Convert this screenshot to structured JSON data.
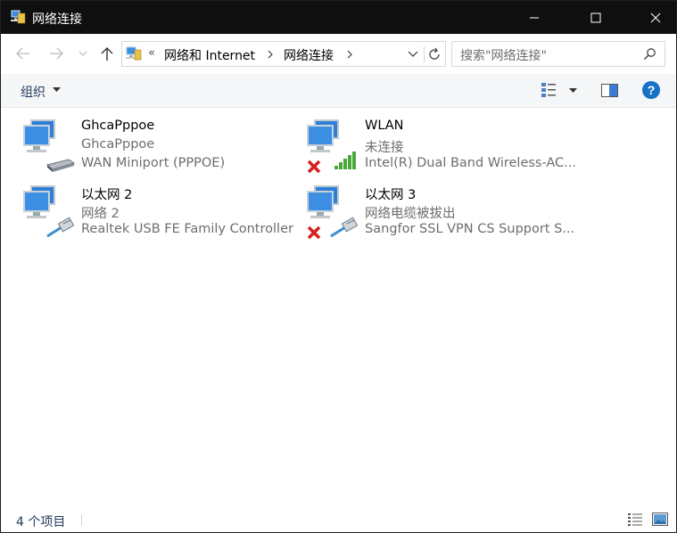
{
  "window": {
    "title": "网络连接",
    "accent": "#0f0f10"
  },
  "address": {
    "overflow": "«",
    "crumbs": [
      "网络和 Internet",
      "网络连接"
    ],
    "search_placeholder": "搜索\"网络连接\""
  },
  "commandbar": {
    "organize_label": "组织",
    "help_label": "?"
  },
  "connections": [
    {
      "name": "GhcaPppoe",
      "status": "GhcaPppoe",
      "device": "WAN Miniport (PPPOE)",
      "overlay": "modem-icon",
      "disconnected": false
    },
    {
      "name": "WLAN",
      "status": "未连接",
      "device": "Intel(R) Dual Band Wireless-AC...",
      "overlay": "wifi-signal-icon",
      "disconnected": true
    },
    {
      "name": "以太网 2",
      "status": "网络  2",
      "device": "Realtek USB FE Family Controller",
      "overlay": "ethernet-cable-icon",
      "disconnected": false
    },
    {
      "name": "以太网 3",
      "status": "网络电缆被拔出",
      "device": "Sangfor SSL VPN CS Support S...",
      "overlay": "ethernet-cable-icon",
      "disconnected": true
    }
  ],
  "statusbar": {
    "item_count": "4 个项目"
  }
}
